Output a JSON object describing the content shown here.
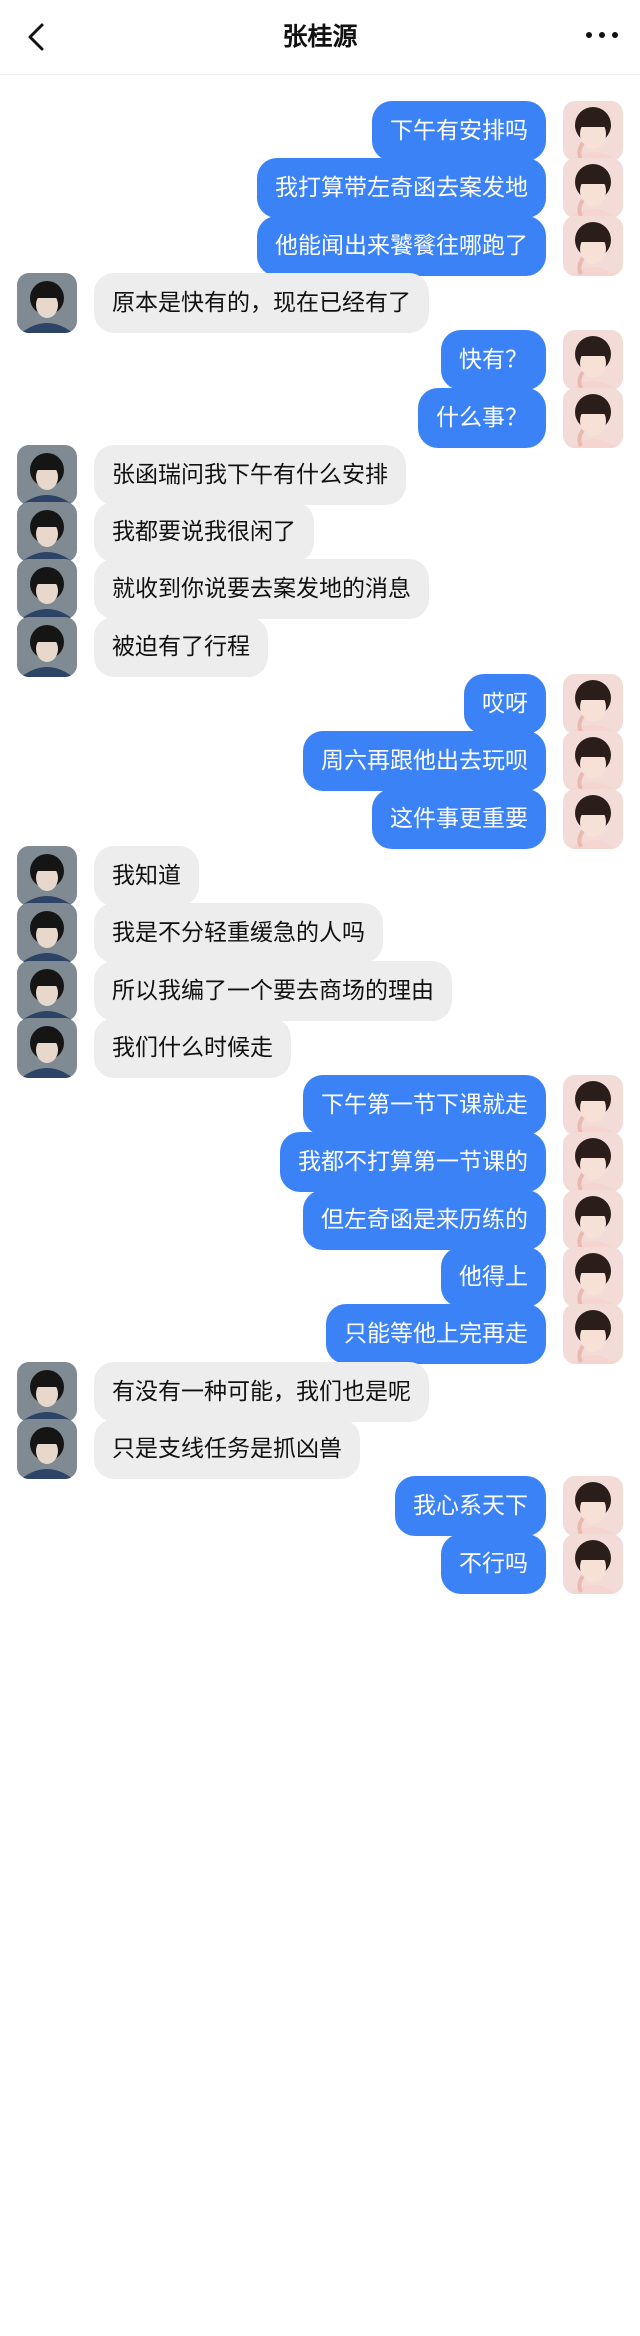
{
  "header": {
    "title": "张桂源"
  },
  "colors": {
    "outgoing_bubble": "#3b82f6",
    "incoming_bubble": "#ededed"
  },
  "messages": [
    {
      "side": "out",
      "text": "下午有安排吗"
    },
    {
      "side": "out",
      "text": "我打算带左奇函去案发地"
    },
    {
      "side": "out",
      "text": "他能闻出来饕餮往哪跑了"
    },
    {
      "side": "in",
      "text": "原本是快有的，现在已经有了"
    },
    {
      "side": "out",
      "text": "快有？"
    },
    {
      "side": "out",
      "text": "什么事？"
    },
    {
      "side": "in",
      "text": "张函瑞问我下午有什么安排"
    },
    {
      "side": "in",
      "text": "我都要说我很闲了"
    },
    {
      "side": "in",
      "text": "就收到你说要去案发地的消息"
    },
    {
      "side": "in",
      "text": "被迫有了行程"
    },
    {
      "side": "out",
      "text": "哎呀"
    },
    {
      "side": "out",
      "text": "周六再跟他出去玩呗"
    },
    {
      "side": "out",
      "text": "这件事更重要"
    },
    {
      "side": "in",
      "text": "我知道"
    },
    {
      "side": "in",
      "text": "我是不分轻重缓急的人吗"
    },
    {
      "side": "in",
      "text": "所以我编了一个要去商场的理由"
    },
    {
      "side": "in",
      "text": "我们什么时候走"
    },
    {
      "side": "out",
      "text": "下午第一节下课就走"
    },
    {
      "side": "out",
      "text": "我都不打算第一节课的"
    },
    {
      "side": "out",
      "text": "但左奇函是来历练的"
    },
    {
      "side": "out",
      "text": "他得上"
    },
    {
      "side": "out",
      "text": "只能等他上完再走"
    },
    {
      "side": "in",
      "text": "有没有一种可能，我们也是呢"
    },
    {
      "side": "in",
      "text": "只是支线任务是抓凶兽"
    },
    {
      "side": "out",
      "text": "我心系天下"
    },
    {
      "side": "out",
      "text": "不行吗"
    }
  ]
}
